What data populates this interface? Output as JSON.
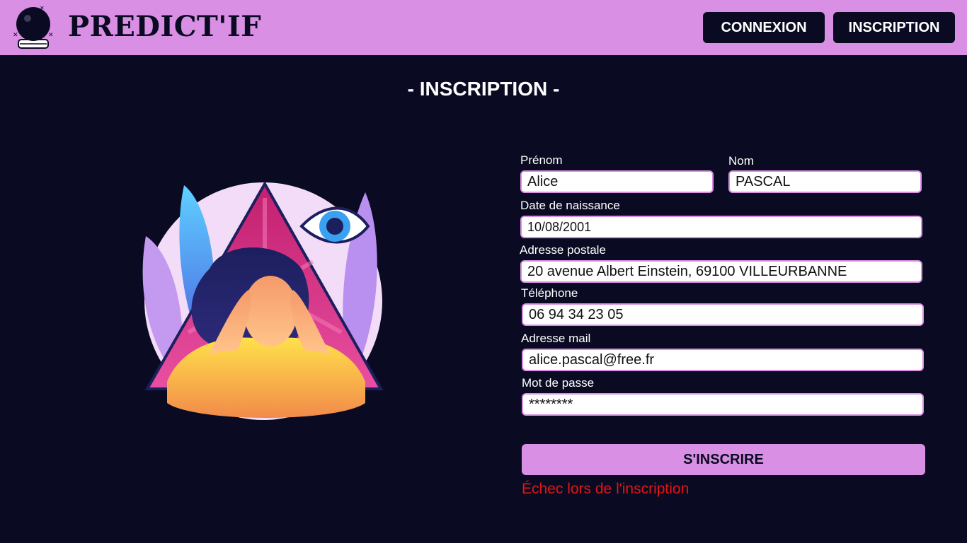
{
  "header": {
    "brand": "PREDICT'IF",
    "logo_icon": "crystal-ball-icon",
    "nav": {
      "connexion_label": "CONNEXION",
      "inscription_label": "INSCRIPTION"
    }
  },
  "page": {
    "title": "- INSCRIPTION -"
  },
  "illustration": {
    "icon": "mystic-eye-triangle-illustration"
  },
  "form": {
    "prenom": {
      "label": "Prénom",
      "value": "Alice"
    },
    "nom": {
      "label": "Nom",
      "value": "PASCAL"
    },
    "date_naissance": {
      "label": "Date de naissance",
      "value": "10/08/2001"
    },
    "adresse": {
      "label": "Adresse postale",
      "value": "20 avenue Albert Einstein, 69100 VILLEURBANNE"
    },
    "telephone": {
      "label": "Téléphone",
      "value": "06 94 34 23 05"
    },
    "email": {
      "label": "Adresse mail",
      "value": "alice.pascal@free.fr"
    },
    "password": {
      "label": "Mot de passe",
      "value": "********"
    },
    "submit_label": "S'INSCRIRE",
    "error_message": "Échec lors de l'inscription"
  },
  "colors": {
    "background": "#0a0b22",
    "accent": "#d98fe3",
    "error": "#e01616"
  }
}
